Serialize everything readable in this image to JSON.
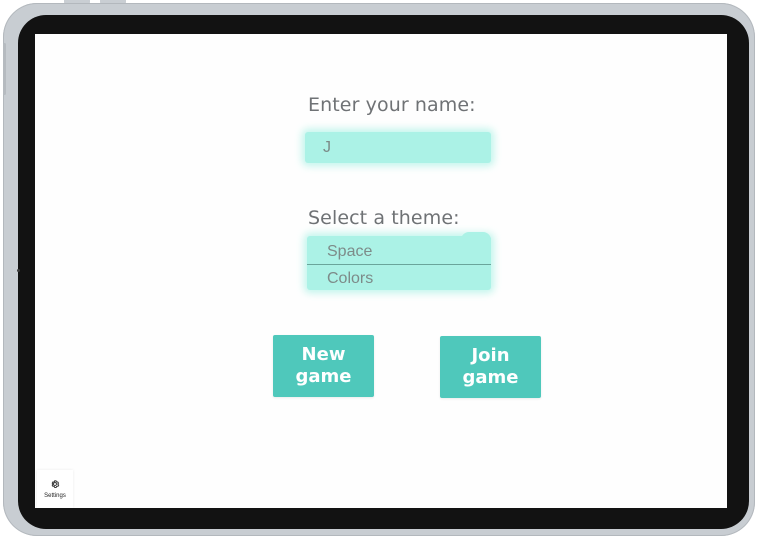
{
  "form": {
    "name_label": "Enter your name:",
    "name_value": "J",
    "theme_label": "Select a theme:",
    "theme_options": [
      "Space",
      "Colors"
    ]
  },
  "buttons": {
    "new_game_line1": "New",
    "new_game_line2": "game",
    "join_game_line1": "Join",
    "join_game_line2": "game"
  },
  "settings": {
    "label": "Settings",
    "icon": "gear-icon"
  },
  "colors": {
    "accent_light": "#abf2e6",
    "accent_button": "#4fc8bb",
    "label_text": "#6f7275"
  }
}
